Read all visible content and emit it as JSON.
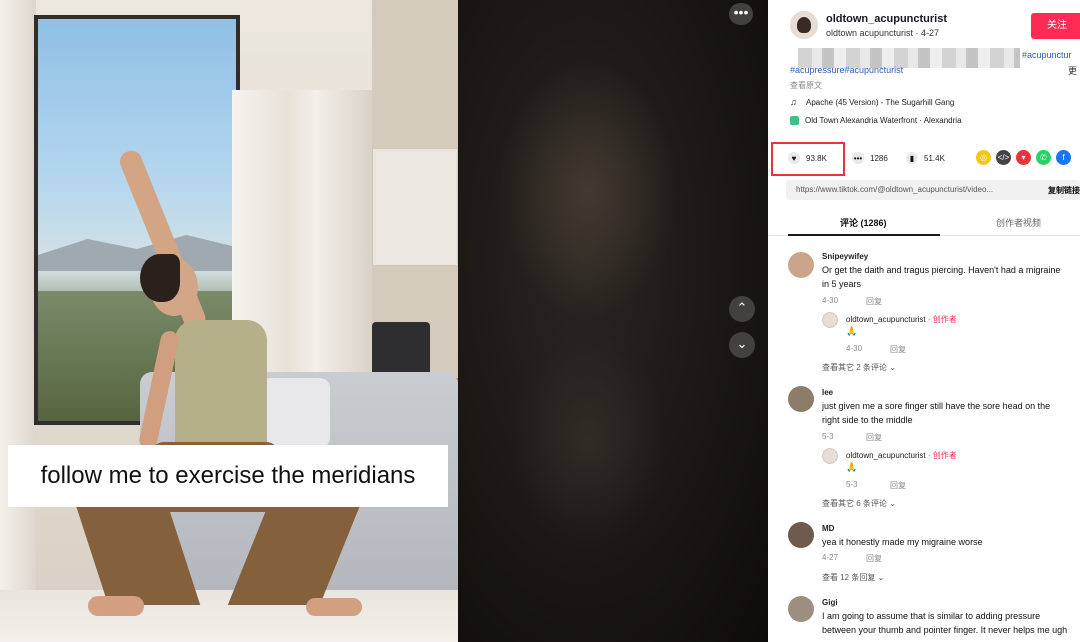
{
  "video": {
    "caption": "follow me to exercise the meridians",
    "more_glyph": "•••",
    "prev_glyph": "⌃",
    "next_glyph": "⌄"
  },
  "author": {
    "name": "oldtown_acupuncturist",
    "sub": "oldtown acupuncturist · 4-27",
    "follow_label": "关注"
  },
  "description": {
    "tag_right": "#acupunctur",
    "tags": "#acupressure#acupuncturist",
    "more": "更",
    "view_original": "查看原文",
    "music": "Apache (45 Version) - The Sugarhill Gang",
    "location": "Old Town Alexandria Waterfront · Alexandria"
  },
  "stats": {
    "likes": "93.8K",
    "comments": "1286",
    "saves": "51.4K"
  },
  "link": {
    "url": "https://www.tiktok.com/@oldtown_acupuncturist/video...",
    "copy_label": "复制链接"
  },
  "tabs": {
    "comments": "评论 (1286)",
    "creator_videos": "创作者视频"
  },
  "comments": [
    {
      "name": "Snipeywifey",
      "text": "Or get the daith and tragus piercing. Haven't had a migraine in 5 years",
      "date": "4-30",
      "reply_label": "回复",
      "author_reply": {
        "name": "oldtown_acupuncturist",
        "badge": "· 创作者",
        "emoji": "🙏",
        "date": "4-30",
        "reply_label": "回复"
      },
      "expand": "查看其它 2 条评论 ⌄"
    },
    {
      "name": "lee",
      "text": "just given me a sore finger still have the sore head on the right side to the middle",
      "date": "5-3",
      "reply_label": "回复",
      "author_reply": {
        "name": "oldtown_acupuncturist",
        "badge": "· 创作者",
        "emoji": "🙏",
        "date": "5-3",
        "reply_label": "回复"
      },
      "expand": "查看其它 6 条评论 ⌄"
    },
    {
      "name": "MD",
      "text": "yea it honestly made my migraine worse",
      "date": "4-27",
      "reply_label": "回复",
      "expand": "查看 12 条回复 ⌄"
    },
    {
      "name": "Gigi",
      "text": "I am going to assume that is similar to adding pressure between your thumb and pointer finger. It never helps me ugh"
    }
  ],
  "colors": {
    "accent": "#fe2c55",
    "highlight_box": "#e8323c",
    "link": "#2b5db9"
  }
}
